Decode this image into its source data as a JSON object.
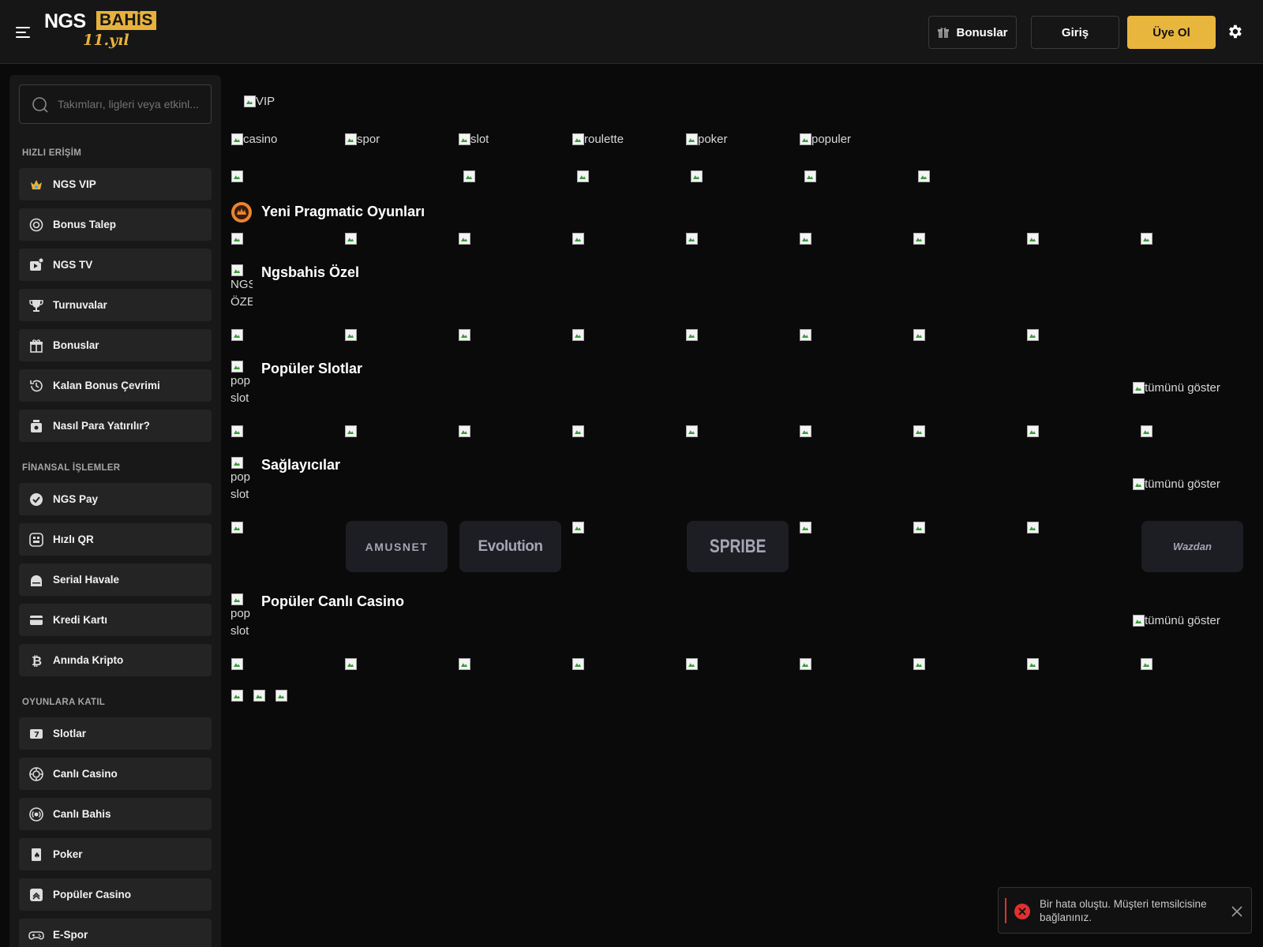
{
  "header": {
    "logo_ngs": "NGS",
    "logo_bahis": "BAHİS",
    "logo_yil": "11.yıl",
    "bonus_label": "Bonuslar",
    "login_label": "Giriş",
    "register_label": "Üye Ol",
    "accent_color": "#e9b63d"
  },
  "sidebar": {
    "search_placeholder": "Takımları, ligleri veya etkinl...",
    "sections": {
      "quick": "HIZLI ERİŞİM",
      "finance": "FİNANSAL İŞLEMLER",
      "games": "OYUNLARA KATIL"
    },
    "quick_items": [
      {
        "label": "NGS VIP",
        "icon": "crown-icon"
      },
      {
        "label": "Bonus Talep",
        "icon": "bonus-request-icon"
      },
      {
        "label": "NGS TV",
        "icon": "tv-icon"
      },
      {
        "label": "Turnuvalar",
        "icon": "trophy-icon"
      },
      {
        "label": "Bonuslar",
        "icon": "gift-icon"
      },
      {
        "label": "Kalan Bonus Çevrimi",
        "icon": "history-icon"
      },
      {
        "label": "Nasıl Para Yatırılır?",
        "icon": "deposit-icon"
      }
    ],
    "finance_items": [
      {
        "label": "NGS Pay",
        "icon": "check-circle-icon"
      },
      {
        "label": "Hızlı QR",
        "icon": "qr-icon"
      },
      {
        "label": "Serial Havale",
        "icon": "bank-icon"
      },
      {
        "label": "Kredi Kartı",
        "icon": "credit-card-icon"
      },
      {
        "label": "Anında Kripto",
        "icon": "bitcoin-icon"
      }
    ],
    "game_items": [
      {
        "label": "Slotlar",
        "icon": "slot-icon"
      },
      {
        "label": "Canlı Casino",
        "icon": "casino-chip-icon"
      },
      {
        "label": "Canlı Bahis",
        "icon": "live-icon"
      },
      {
        "label": "Poker",
        "icon": "poker-card-icon"
      },
      {
        "label": "Popüler Casino",
        "icon": "popular-icon"
      },
      {
        "label": "E-Spor",
        "icon": "gamepad-icon"
      }
    ]
  },
  "main": {
    "vip_alt": "VIP",
    "categories": [
      "casino",
      "spor",
      "slot",
      "roulette",
      "poker",
      "populer"
    ],
    "sections": {
      "pragmatic": "Yeni Pragmatic Oyunları",
      "ozel": "Ngsbahis Özel",
      "ozel_alt": [
        "NGS",
        "ÖZEL"
      ],
      "slotlar": "Popüler Slotlar",
      "saglayicilar": "Sağlayıcılar",
      "canli": "Popüler Canlı Casino",
      "popular_alt": [
        "pop",
        "slot"
      ]
    },
    "show_all_alt": "tümünü göster",
    "providers": [
      "AMUSNET",
      "Evolution",
      "SPRIBE",
      "Wazdan"
    ]
  },
  "toast": {
    "message": "Bir hata oluştu. Müşteri temsilcisine bağlanınız."
  }
}
